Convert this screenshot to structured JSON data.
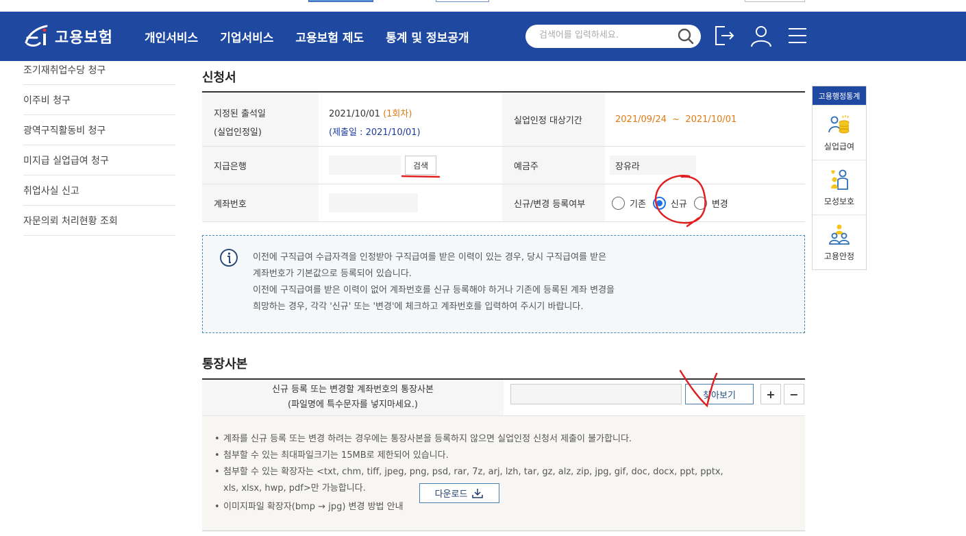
{
  "header": {
    "logo_text": "고용보험",
    "nav": [
      "개인서비스",
      "기업서비스",
      "고용보험 제도",
      "통계 및 정보공개"
    ],
    "search_placeholder": "검색어를 입력하세요."
  },
  "sidebar": {
    "items": [
      {
        "label": "조기재취업수당 청구"
      },
      {
        "label": "이주비 청구"
      },
      {
        "label": "광역구직활동비 청구"
      },
      {
        "label": "미지급 실업급여 청구"
      },
      {
        "label": "취업사실 신고"
      },
      {
        "label": "자문의뢰 처리현황 조회"
      }
    ]
  },
  "application": {
    "title": "신청서",
    "attendance_label_1": "지정된 출석일",
    "attendance_label_2": "(실업인정일)",
    "attendance_date": "2021/10/01",
    "attendance_round": "(1회차)",
    "submit_date": "(제출일 : 2021/10/01)",
    "period_label": "실업인정 대상기간",
    "period_value": "2021/09/24  ~  2021/10/01",
    "bank_label": "지급은행",
    "bank_search_button": "검색",
    "depositor_label": "예금주",
    "depositor_value": "장유라",
    "account_label": "계좌번호",
    "register_label": "신규/변경 등록여부",
    "register_options": [
      "기존",
      "신규",
      "변경"
    ],
    "register_selected": "신규"
  },
  "notice": {
    "line1": "이전에 구직급여 수급자격을 인정받아 구직급여를 받은 이력이 있는 경우, 당시 구직급여를 받은",
    "line2": "계좌번호가 기본값으로 등록되어 있습니다.",
    "line3": "이전에 구직급여를 받은 이력이 없어 계좌번호를 신규 등록해야 하거나 기존에 등록된 계좌 변경을",
    "line4": "희망하는 경우, 각각 '신규' 또는 '변경'에 체크하고 계좌번호를 입력하여 주시기 바랍니다."
  },
  "attachment": {
    "title": "통장사본",
    "label_1": "신규 등록 또는 변경할 계좌번호의 통장사본",
    "label_2": "(파일명에 특수문자를 넣지마세요.)",
    "browse_button": "찾아보기",
    "plus": "+",
    "minus": "−",
    "guide": [
      "계좌를 신규 등록 또는 변경 하려는 경우에는 통장사본을 등록하지 않으면 실업인정 신청서 제출이 불가합니다.",
      "첨부할 수 있는 최대파일크기는 15MB로 제한되어 있습니다.",
      "첨부할 수 있는 확장자는 <txt, chm, tiff, jpeg, png, psd, rar, 7z, arj, lzh, tar, gz, alz, zip, jpg, gif, doc, docx, ppt, pptx,",
      "xls, xlsx, hwp, pdf>만 가능합니다.",
      "이미지파일 확장자(bmp → jpg) 변경 방법 안내"
    ],
    "download_button": "다운로드"
  },
  "quick_menu": {
    "title": "고용행정통계",
    "items": [
      {
        "label": "실업급여",
        "icon": "coins-person-icon"
      },
      {
        "label": "모성보호",
        "icon": "mother-child-icon"
      },
      {
        "label": "고용안정",
        "icon": "people-group-icon"
      }
    ]
  },
  "colors": {
    "header_bg": "#1f48a0",
    "accent_orange": "#e07a12",
    "annotation_red": "#e02020"
  }
}
